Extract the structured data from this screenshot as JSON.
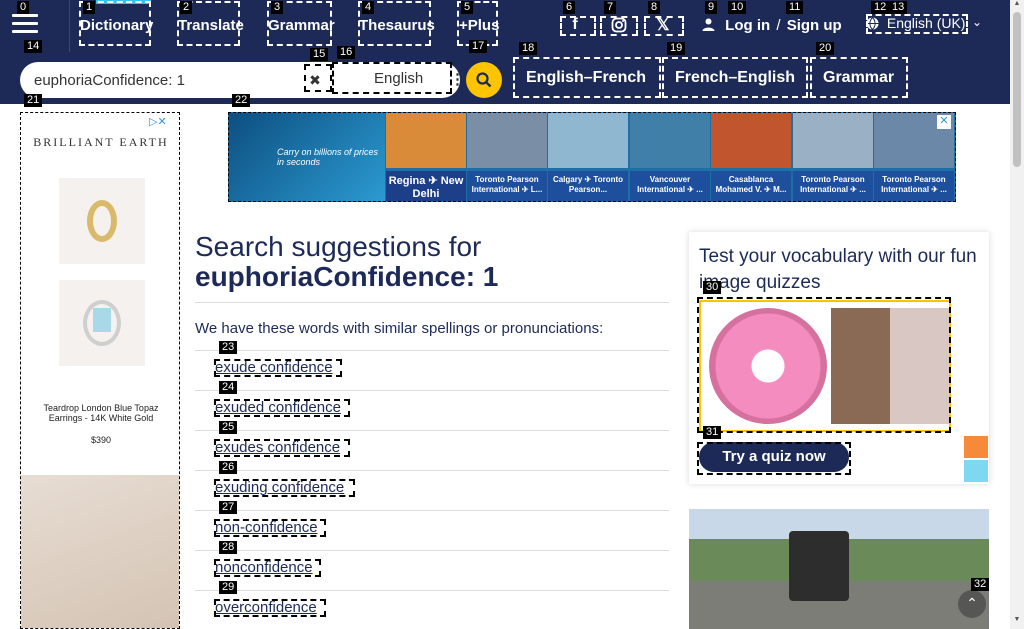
{
  "topnav": {
    "links": [
      "Dictionary",
      "Translate",
      "Grammar",
      "Thesaurus",
      "+Plus"
    ],
    "social_icons": [
      "facebook-icon",
      "instagram-icon",
      "x-twitter-icon"
    ],
    "login": {
      "log_in": "Log in",
      "sep": "/",
      "sign_up": "Sign up"
    },
    "language": "English (UK)"
  },
  "search": {
    "value": "euphoriaConfidence: 1",
    "dictionary": "English",
    "sub_links": [
      "English–French",
      "French–English",
      "Grammar"
    ]
  },
  "ad_left": {
    "brand": "BRILLIANT EARTH",
    "item_name": "Teardrop London Blue Topaz Earrings - 14K White Gold",
    "price": "$390"
  },
  "ad_top": {
    "hero_text": "Carry on billions of prices in seconds",
    "tiles": [
      {
        "caption": "Regina ✈ New Delhi",
        "color": "#d98b3a"
      },
      {
        "caption": "Toronto Pearson International ✈ L...",
        "color": "#7a8fa6"
      },
      {
        "caption": "Calgary ✈ Toronto Pearson...",
        "color": "#8fb7cf"
      },
      {
        "caption": "Vancouver International ✈ ...",
        "color": "#3f7fa8"
      },
      {
        "caption": "Casablanca Mohamed V. ✈ M...",
        "color": "#c0552e"
      },
      {
        "caption": "Toronto Pearson International ✈ ...",
        "color": "#9ab0c4"
      },
      {
        "caption": "Toronto Pearson International ✈ ...",
        "color": "#6b88a8"
      }
    ]
  },
  "main": {
    "title_prefix": "Search suggestions for",
    "title_query": "euphoriaConfidence: 1",
    "intro": "We have these words with similar spellings or pronunciations:",
    "suggestions": [
      "exude confidence",
      "exuded confidence",
      "exudes confidence",
      "exuding confidence",
      "non-confidence",
      "nonconfidence",
      "overconfidence"
    ]
  },
  "quiz": {
    "title": "Test your vocabulary with our fun image quizzes",
    "button": "Try a quiz now"
  },
  "badges": [
    "0",
    "1",
    "2",
    "3",
    "4",
    "5",
    "6",
    "7",
    "8",
    "9",
    "10",
    "11",
    "12",
    "13",
    "14",
    "15",
    "16",
    "17",
    "18",
    "19",
    "20",
    "21",
    "22",
    "23",
    "24",
    "25",
    "26",
    "27",
    "28",
    "29",
    "30",
    "31",
    "32"
  ]
}
